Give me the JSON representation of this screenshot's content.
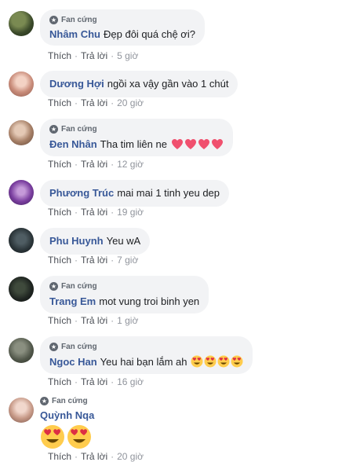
{
  "badge_label": "Fan cứng",
  "like_label": "Thích",
  "reply_label": "Trả lời",
  "separator": "·",
  "comments": [
    {
      "author": "Nhâm Chu",
      "text": "Đẹp đôi quá chệ ơi?",
      "time": "5 giờ",
      "fan": true
    },
    {
      "author": "Dương Hợi",
      "text": "ngồi xa vậy gần vào 1 chút",
      "time": "20 giờ",
      "fan": false
    },
    {
      "author": "Đen Nhân",
      "text": "Tha tim liên ne",
      "time": "12 giờ",
      "fan": true,
      "emoji": [
        "heart-emoji",
        "heart-emoji",
        "heart-emoji",
        "heart-emoji"
      ]
    },
    {
      "author": "Phương Trúc",
      "text": "mai mai 1 tinh yeu dep",
      "time": "19 giờ",
      "fan": false
    },
    {
      "author": "Phu Huynh",
      "text": "Yeu wA",
      "time": "7 giờ",
      "fan": false
    },
    {
      "author": "Trang Em",
      "text": "mot vung troi binh yen",
      "time": "1 giờ",
      "fan": true
    },
    {
      "author": "Ngoc Han",
      "text": "Yeu hai bạn lắm ah",
      "time": "16 giờ",
      "fan": true,
      "emoji": [
        "heart-eyes-emoji",
        "heart-eyes-emoji",
        "heart-eyes-emoji",
        "heart-eyes-emoji"
      ]
    },
    {
      "author": "Quỳnh Nqa",
      "text": "",
      "time": "20 giờ",
      "fan": true,
      "emoji": [
        "heart-eyes-emoji",
        "heart-eyes-emoji"
      ]
    }
  ],
  "colors": {
    "author": "#385898",
    "bubble": "#f2f3f5",
    "heart": "#f0506e",
    "emoji_face": "#ffcc4d"
  }
}
